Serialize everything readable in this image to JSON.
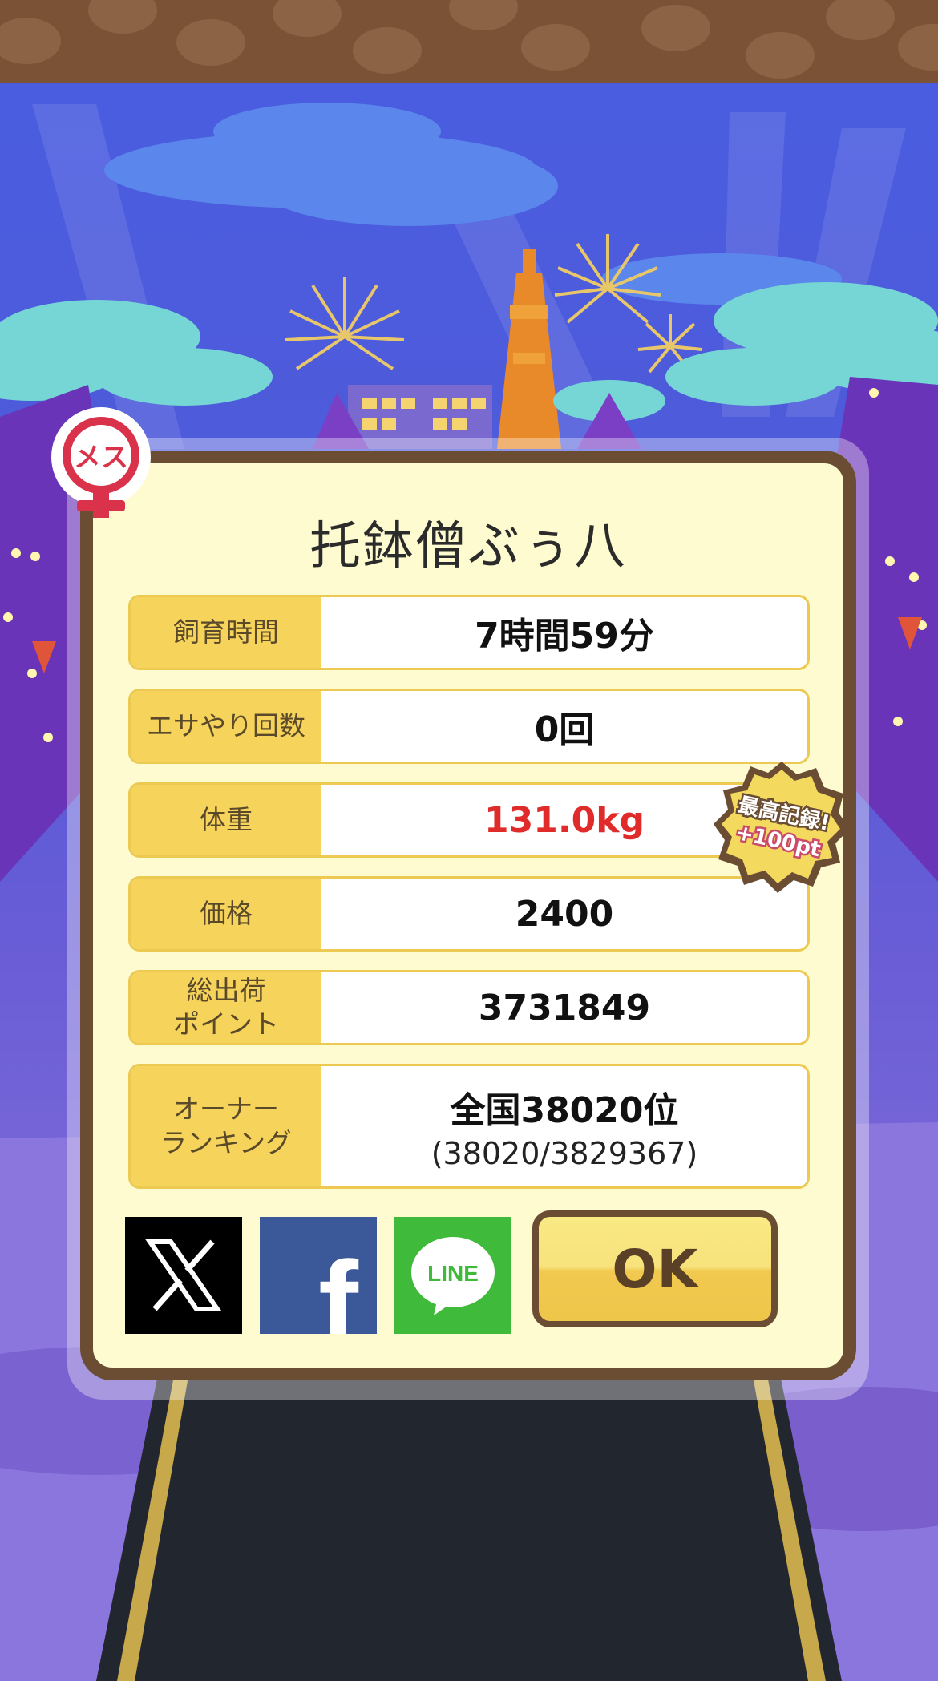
{
  "gender_badge": {
    "label": "メス"
  },
  "dialog": {
    "title": "托鉢僧ぶぅ八",
    "stats": [
      {
        "label": "飼育時間",
        "value": "7時間59分"
      },
      {
        "label": "エサやり回数",
        "value": "0回"
      },
      {
        "label": "体重",
        "value": "131.0kg",
        "highlight": "#e02b2b"
      },
      {
        "label": "価格",
        "value": "2400"
      },
      {
        "label": "総出荷\nポイント",
        "value": "3731849"
      },
      {
        "label": "オーナー\nランキング",
        "value": "全国38020位",
        "sub": "(38020/3829367)"
      }
    ],
    "record_badge": {
      "line1": "最高記録!",
      "line2": "+100pt"
    },
    "share": {
      "x": "X",
      "facebook": "f",
      "line": "LINE"
    },
    "ok_label": "OK"
  },
  "colors": {
    "dialog_bg": "#fefbd1",
    "label_bg": "#f6d35a",
    "border": "#6b4d33",
    "x": "#000000",
    "facebook": "#3b5998",
    "line": "#3fba3a"
  }
}
